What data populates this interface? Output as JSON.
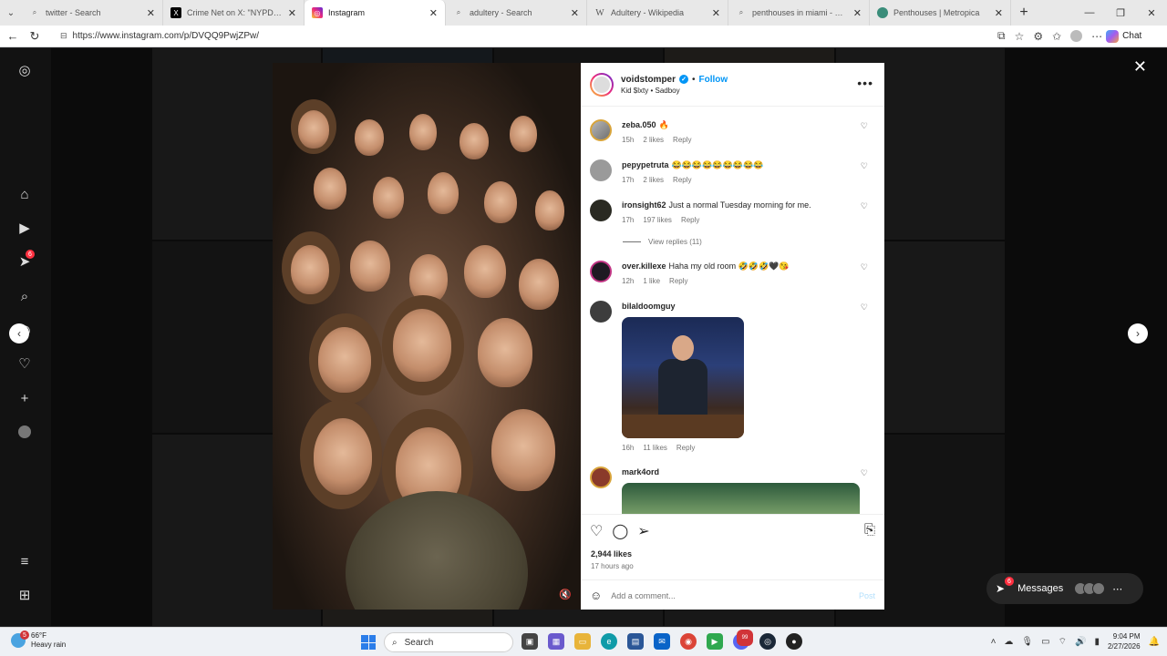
{
  "browser": {
    "tabs": [
      {
        "title": "twitter - Search",
        "icon": "search-icon",
        "active": false
      },
      {
        "title": "Crime Net on X: \"NYPD officer is ...",
        "icon": "x-logo-icon",
        "active": false
      },
      {
        "title": "Instagram",
        "icon": "instagram-icon",
        "active": true
      },
      {
        "title": "adultery - Search",
        "icon": "search-icon",
        "active": false
      },
      {
        "title": "Adultery - Wikipedia",
        "icon": "wikipedia-icon",
        "active": false
      },
      {
        "title": "penthouses in miami - Search",
        "icon": "search-icon",
        "active": false
      },
      {
        "title": "Penthouses | Metropica",
        "icon": "globe-icon",
        "active": false
      }
    ],
    "url": "https://www.instagram.com/p/DVQQ9PwjZPw/",
    "chat_label": "Chat"
  },
  "sidebar": {
    "notification_count": "6"
  },
  "post": {
    "username": "voidstomper",
    "follow_label": "Follow",
    "subtitle": "Kid $lxty • Sadboy",
    "likes": "2,944 likes",
    "time": "17 hours ago",
    "comment_placeholder": "Add a comment...",
    "post_label": "Post"
  },
  "comments": [
    {
      "user": "zeba.050",
      "text": "🔥",
      "time": "15h",
      "likes": "2 likes",
      "reply": "Reply"
    },
    {
      "user": "pepypetruta",
      "text": "😂😂😂😂😂😂😂😂😂",
      "time": "17h",
      "likes": "2 likes",
      "reply": "Reply"
    },
    {
      "user": "ironsight62",
      "text": "Just a normal Tuesday morning for me.",
      "time": "17h",
      "likes": "197 likes",
      "reply": "Reply",
      "view_replies": "View replies (11)"
    },
    {
      "user": "over.killexe",
      "text": "Haha my old room 🤣🤣🤣🖤😘",
      "time": "12h",
      "likes": "1 like",
      "reply": "Reply"
    },
    {
      "user": "biIaldoomguy",
      "text": "",
      "time": "16h",
      "likes": "11 likes",
      "reply": "Reply"
    },
    {
      "user": "mark4ord",
      "text": "",
      "time": "",
      "likes": "",
      "reply": ""
    }
  ],
  "messages": {
    "label": "Messages",
    "badge": "6"
  },
  "taskbar": {
    "temperature": "66°F",
    "weather": "Heavy rain",
    "weather_badge": "5",
    "search_label": "Search",
    "time": "9:04 PM",
    "date": "2/27/2026",
    "discord_badge": "99"
  }
}
